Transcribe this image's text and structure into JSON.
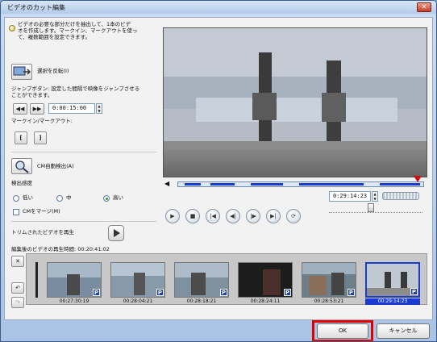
{
  "window": {
    "title": "ビデオのカット編集",
    "close_label": "✕"
  },
  "info": {
    "text_line1": "ビデオの必要な部分だけを抽出して、1本のビデ",
    "text_line2": "オを作成します。マークイン、マークアウトを使っ",
    "text_line3": "て、複数範囲を設定できます。"
  },
  "selection": {
    "invert_label": "選択を反転(I)",
    "jump_desc_line1": "ジャンプボタン: 設定した間隔で映像をジャンプさせる",
    "jump_desc_line2": "ことができます。",
    "rewind_label": "◀◀",
    "forward_label": "▶▶",
    "jump_interval": "0:00:15:00",
    "mark_label": "マークイン/マークアウト:",
    "mark_in_label": "[",
    "mark_out_label": "]"
  },
  "cm": {
    "detect_label": "CM自動検出(A)",
    "sensitivity_label": "検出感度",
    "options": [
      "低い",
      "中",
      "高い"
    ],
    "selected": "高い",
    "merge_label": "CMをマージ(M)"
  },
  "playback": {
    "trim_play_label": "トリムされたビデオを再生",
    "duration_label": "編集後のビデオの再生時間: 00:20:41:02",
    "timecode": "0:29:14:23"
  },
  "thumbnails": [
    {
      "time": "00:27:30:19",
      "badge": "P",
      "selected": false
    },
    {
      "time": "00:28:04:21",
      "badge": "P",
      "selected": false
    },
    {
      "time": "00:28:18:21",
      "badge": "P",
      "selected": false
    },
    {
      "time": "00:28:24:11",
      "badge": "P",
      "selected": false
    },
    {
      "time": "00:28:53:21",
      "badge": "P",
      "selected": false
    },
    {
      "time": "00:29:14:23",
      "badge": "P",
      "selected": true
    }
  ],
  "buttons": {
    "ok_label": "OK",
    "cancel_label": "キャンセル"
  },
  "colors": {
    "accent": "#1c3fa8",
    "ok_highlight": "#e00000",
    "selection": "#1a3ad0"
  }
}
